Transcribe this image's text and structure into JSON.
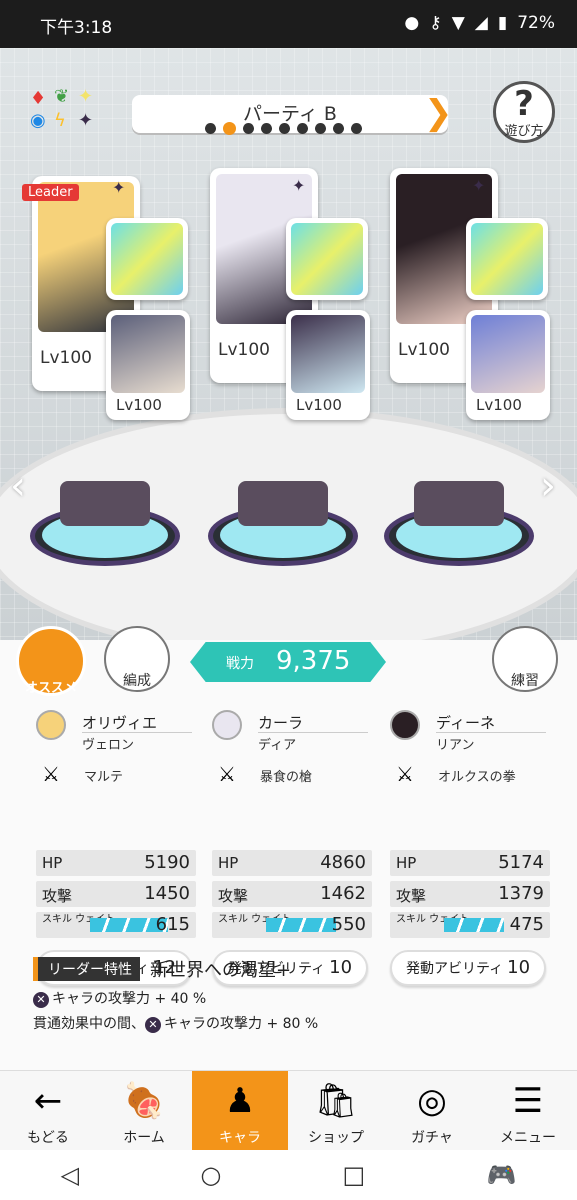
{
  "status": {
    "time": "下午3:18",
    "battery": "72%"
  },
  "party": {
    "title": "パーティ B",
    "page_count": 9,
    "active_page": 2
  },
  "help_label": "遊び方",
  "leader_label": "Leader",
  "cards": [
    {
      "lv": "Lv100",
      "sub_lv": "Lv100",
      "colors": [
        "#f6d27a",
        "#2b2f3a"
      ],
      "sub_colors": [
        "#5b5f7a",
        "#e8ddd0"
      ]
    },
    {
      "lv": "Lv100",
      "sub_lv": "Lv100",
      "colors": [
        "#e9e6f0",
        "#2a2233"
      ],
      "sub_colors": [
        "#3b2f4a",
        "#cfe8f2"
      ]
    },
    {
      "lv": "Lv100",
      "sub_lv": "Lv100",
      "colors": [
        "#2a1f24",
        "#f2d3c9"
      ],
      "sub_colors": [
        "#6e7fd6",
        "#e6d3d0"
      ]
    }
  ],
  "buttons": {
    "osusume": "オススメ",
    "hensei": "編成",
    "renshu": "練習"
  },
  "power": {
    "label": "戦力",
    "value": "9,375"
  },
  "characters": [
    {
      "name": "オリヴィエ",
      "companion": "ヴェロン",
      "weapon": "マルテ",
      "hp": "5190",
      "atk": "1450",
      "wait": "615",
      "wait_pct": 0.78,
      "ability_label": "発動アビリティ",
      "ability_count": "12"
    },
    {
      "name": "カーラ",
      "companion": "ディア",
      "weapon": "暴食の槍",
      "hp": "4860",
      "atk": "1462",
      "wait": "550",
      "wait_pct": 0.7,
      "ability_label": "発動アビリティ",
      "ability_count": "10"
    },
    {
      "name": "ディーネ",
      "companion": "リアン",
      "weapon": "オルクスの拳",
      "hp": "5174",
      "atk": "1379",
      "wait": "475",
      "wait_pct": 0.6,
      "ability_label": "発動アビリティ",
      "ability_count": "10"
    }
  ],
  "stat_labels": {
    "hp": "HP",
    "atk": "攻撃",
    "wait": "スキル ウェイト"
  },
  "leader_skill": {
    "tag": "リーダー特性",
    "title": "新世界への渇望+",
    "effect1": "キャラの攻撃力 + 40 %",
    "effect2_prefix": "貫通効果中の間、",
    "effect2": "キャラの攻撃力 + 80 %"
  },
  "nav": [
    {
      "label": "もどる",
      "icon": "back-arrow-icon"
    },
    {
      "label": "ホーム",
      "icon": "home-icon"
    },
    {
      "label": "キャラ",
      "icon": "character-icon",
      "active": true
    },
    {
      "label": "ショップ",
      "icon": "shop-icon"
    },
    {
      "label": "ガチャ",
      "icon": "gacha-icon"
    },
    {
      "label": "メニュー",
      "icon": "menu-icon"
    }
  ]
}
